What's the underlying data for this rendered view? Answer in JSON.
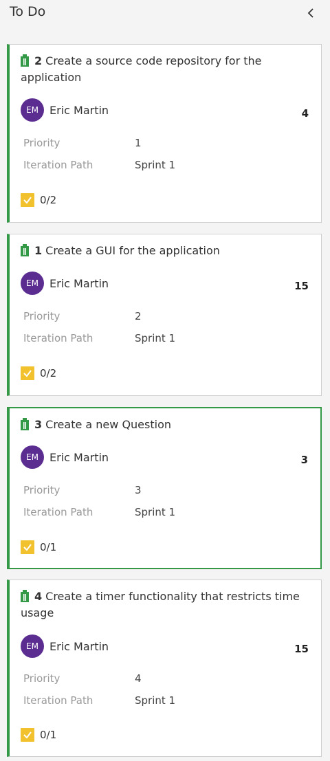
{
  "column": {
    "title": "To Do"
  },
  "field_labels": {
    "priority": "Priority",
    "iteration": "Iteration Path"
  },
  "cards": [
    {
      "id": "2",
      "title": "Create a source code repository for the application",
      "assignee_initials": "EM",
      "assignee": "Eric Martin",
      "effort": "4",
      "priority": "1",
      "iteration": "Sprint 1",
      "tasks": "0/2"
    },
    {
      "id": "1",
      "title": "Create a GUI for the application",
      "assignee_initials": "EM",
      "assignee": "Eric Martin",
      "effort": "15",
      "priority": "2",
      "iteration": "Sprint 1",
      "tasks": "0/2"
    },
    {
      "id": "3",
      "title": "Create a new Question",
      "assignee_initials": "EM",
      "assignee": "Eric Martin",
      "effort": "3",
      "priority": "3",
      "iteration": "Sprint 1",
      "tasks": "0/1"
    },
    {
      "id": "4",
      "title": "Create a timer functionality that restricts time usage",
      "assignee_initials": "EM",
      "assignee": "Eric Martin",
      "effort": "15",
      "priority": "4",
      "iteration": "Sprint 1",
      "tasks": "0/1"
    }
  ],
  "colors": {
    "accent_green": "#339947",
    "avatar_purple": "#5c2d91",
    "task_yellow": "#f2c12e"
  },
  "icons": {
    "backlog_item": "book-icon",
    "collapse": "chevron-left-icon",
    "tasks": "checkbox-icon"
  }
}
